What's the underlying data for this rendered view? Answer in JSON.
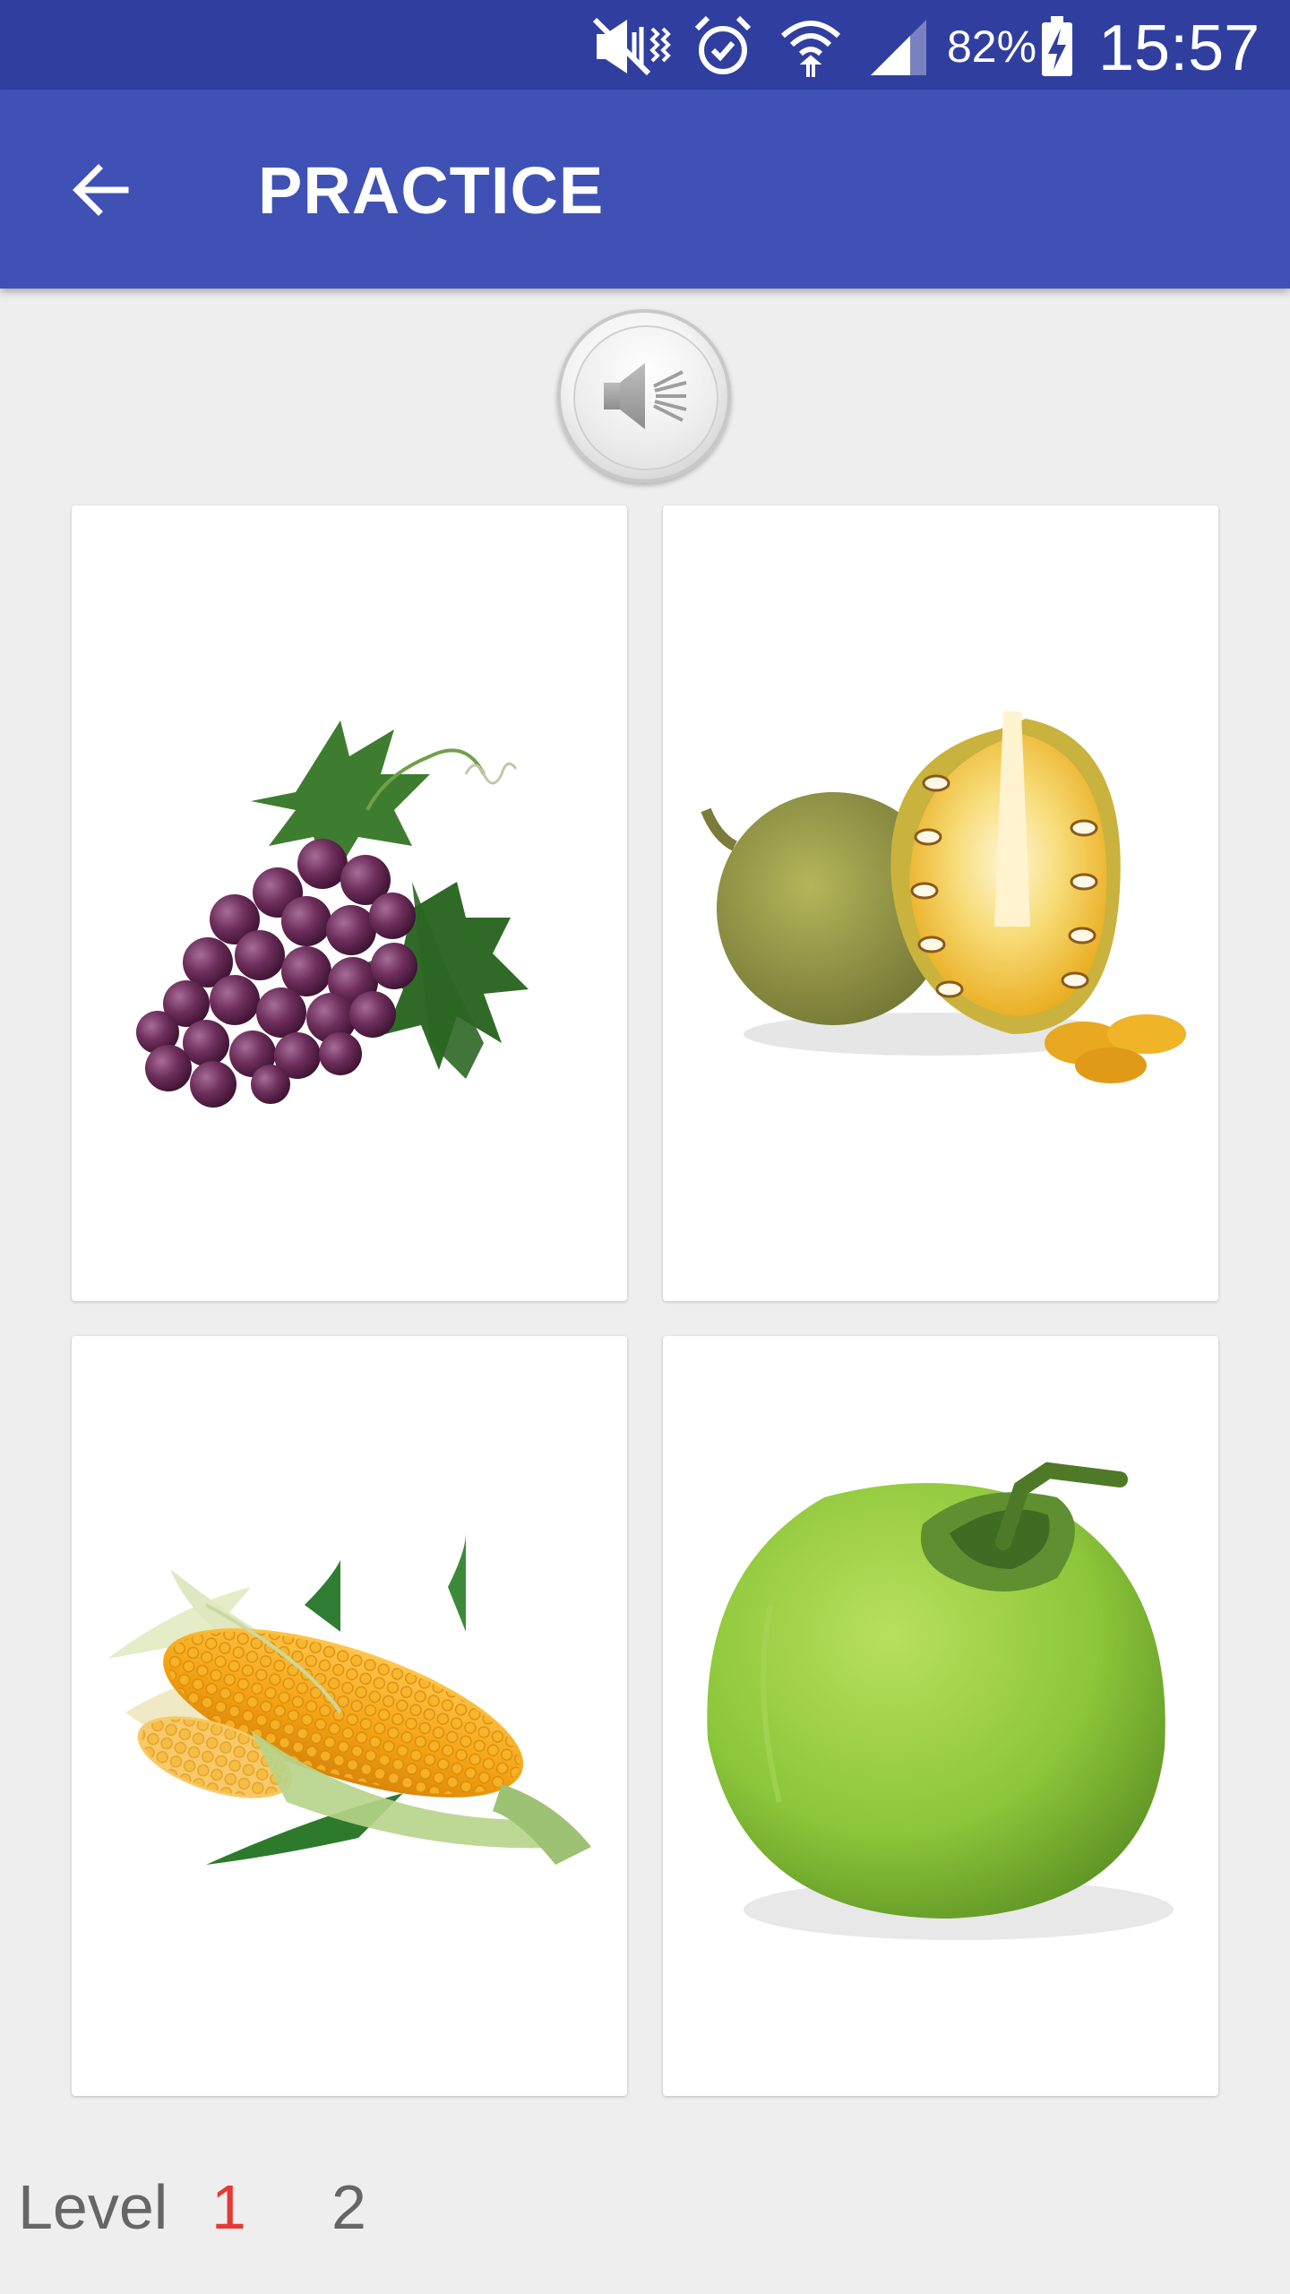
{
  "status_bar": {
    "battery_percent": "82%",
    "time": "15:57",
    "icons": [
      "mute-vibrate-icon",
      "alarm-icon",
      "wifi-icon",
      "signal-icon",
      "battery-charging-icon"
    ]
  },
  "app_bar": {
    "title": "PRACTICE",
    "back_icon": "arrow-left-icon"
  },
  "speaker": {
    "icon": "speaker-icon"
  },
  "cards": [
    {
      "image": "grapes"
    },
    {
      "image": "jackfruit"
    },
    {
      "image": "corn"
    },
    {
      "image": "coconut"
    }
  ],
  "level": {
    "label": "Level",
    "options": [
      "1",
      "2"
    ],
    "selected": "1",
    "selected_color": "#e53935"
  },
  "colors": {
    "status_bar": "#303f9f",
    "app_bar": "#3f51b5",
    "background": "#eeeeee"
  }
}
